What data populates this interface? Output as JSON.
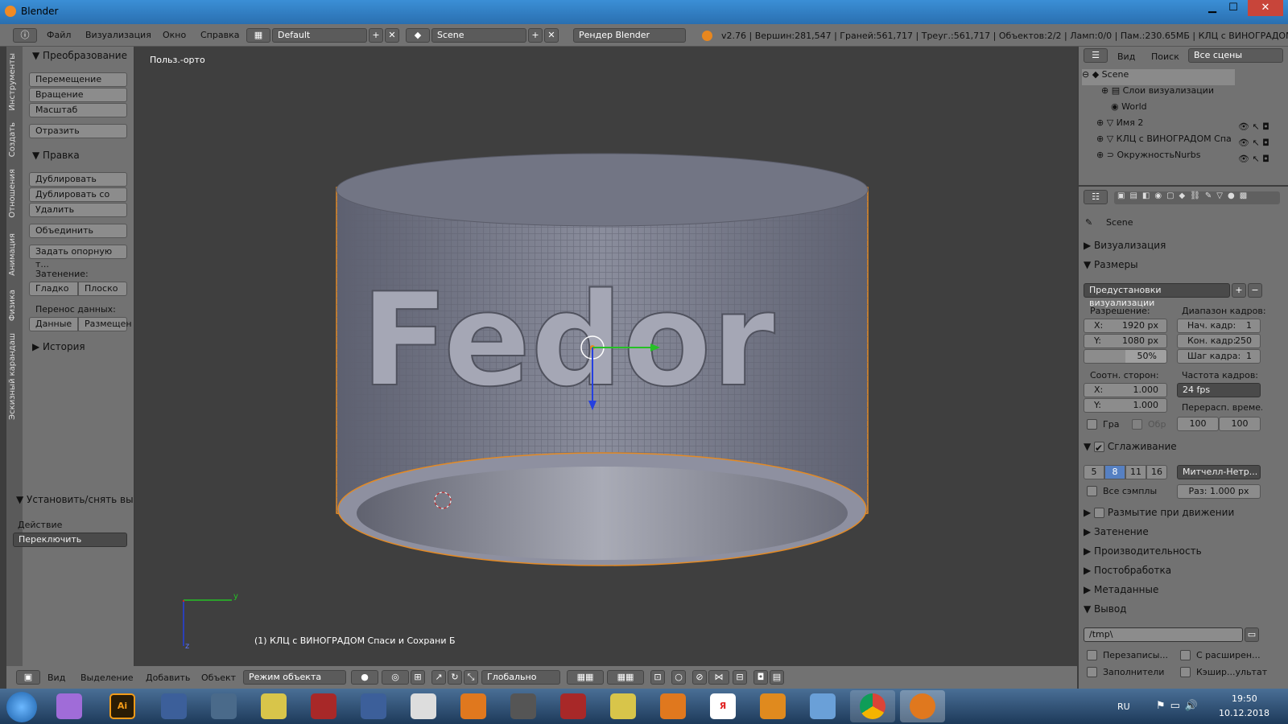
{
  "window": {
    "title": "Blender",
    "min": "▁",
    "max": "☐",
    "close": "✕"
  },
  "menu": {
    "file": "Файл",
    "render": "Визуализация",
    "window": "Окно",
    "help": "Справка"
  },
  "screen": {
    "layout": "Default",
    "scene": "Scene",
    "engine": "Рендер Blender"
  },
  "stats": "v2.76 | Вершин:281,547 | Граней:561,717 | Треуг.:561,717 | Объектов:2/2 | Ламп:0/0 | Пам.:230.65МБ | КЛЦ с ВИНОГРАДОМ Спаси",
  "tabs": [
    "Инструменты",
    "Создать",
    "Отношения",
    "Анимация",
    "Физика",
    "Эскизный карандаш"
  ],
  "tools": {
    "transform_header": "Преобразование",
    "move": "Перемещение",
    "rotate": "Вращение",
    "scale": "Масштаб",
    "mirror": "Отразить",
    "edit_header": "Правка",
    "duplicate": "Дублировать",
    "duplicate_linked": "Дублировать со св...",
    "delete": "Удалить",
    "join": "Объединить",
    "set_origin": "Задать опорную т...",
    "shading_label": "Затенение:",
    "smooth": "Гладко",
    "flat": "Плоско",
    "data_transfer_label": "Перенос данных:",
    "data": "Данные",
    "layout": "Размещен",
    "history_header": "История",
    "operator_header": "Установить/снять выд",
    "action_label": "Действие",
    "action_value": "Переключить"
  },
  "viewport": {
    "view_name": "Польз.-орто",
    "object_info": "(1) КЛЦ  с ВИНОГРАДОМ Спаси и Сохрани Б",
    "axis_x": "y",
    "axis_z": "z",
    "engraving": "Fedor"
  },
  "bottom": {
    "view": "Вид",
    "select": "Выделение",
    "add": "Добавить",
    "object": "Объект",
    "mode": "Режим объекта",
    "orientation": "Глобально"
  },
  "outliner": {
    "view": "Вид",
    "search": "Поиск",
    "filter": "Все сцены",
    "items": [
      {
        "label": "Scene",
        "indent": 0
      },
      {
        "label": "Слои визуализации",
        "indent": 1
      },
      {
        "label": "World",
        "indent": 1
      },
      {
        "label": "Имя 2",
        "indent": 1
      },
      {
        "label": "КЛЦ  с ВИНОГРАДОМ Спа",
        "indent": 1
      },
      {
        "label": "ОкружностьNurbs",
        "indent": 1
      }
    ]
  },
  "properties": {
    "scene": "Scene",
    "render_panel": "Визуализация",
    "dimensions_panel": "Размеры",
    "presets": "Предустановки визуализации",
    "resolution_label": "Разрешение:",
    "res_x": "X:",
    "res_x_val": "1920 px",
    "res_y": "Y:",
    "res_y_val": "1080 px",
    "res_pct": "50%",
    "frame_range_label": "Диапазон кадров:",
    "start": "Нач. кадр:",
    "start_val": "1",
    "end": "Кон. кадр:",
    "end_val": "250",
    "step": "Шаг кадра:",
    "step_val": "1",
    "aspect_label": "Соотн. сторон:",
    "asp_x": "X:",
    "asp_x_val": "1.000",
    "asp_y": "Y:",
    "asp_y_val": "1.000",
    "fps_label": "Частота кадров:",
    "fps": "24 fps",
    "remap_label": "Перерасп. време...",
    "remap_old": "100",
    "remap_new": "100",
    "border": "Гра",
    "crop": "Обр",
    "aa_panel": "Сглаживание",
    "aa_samples": [
      "5",
      "8",
      "11",
      "16"
    ],
    "aa_filter": "Митчелл-Нетр...",
    "full_sample": "Все сэмплы",
    "filter_size": "Раз:  1.000 px",
    "motion_blur": "Размытие при движении",
    "shading": "Затенение",
    "performance": "Производительность",
    "postprocessing": "Постобработка",
    "metadata": "Метаданные",
    "output_panel": "Вывод",
    "output_path": "/tmp\\",
    "overwrite": "Перезаписы...",
    "extensions": "С расширен...",
    "placeholders": "Заполнители",
    "cache_result": "Кэшир...ультат"
  },
  "taskbar": {
    "lang": "RU",
    "time": "19:50",
    "date": "10.12.2018"
  }
}
